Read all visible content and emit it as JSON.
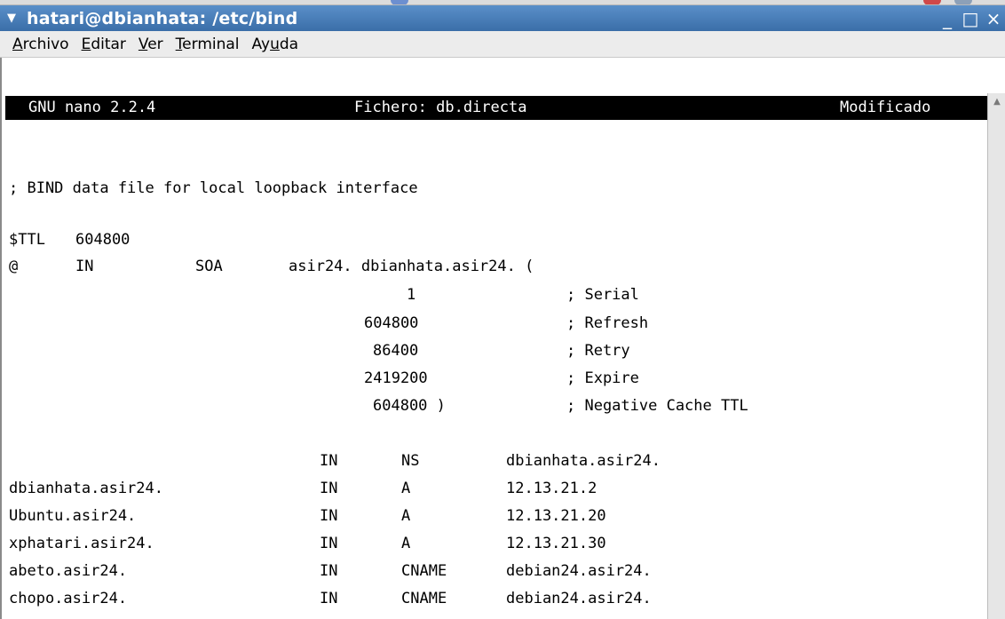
{
  "window": {
    "title": "hatari@dbianhata: /etc/bind",
    "menu_arrow": "▼",
    "controls": {
      "minimize": "_",
      "maximize": "□",
      "close": "×"
    }
  },
  "menubar": {
    "items": [
      {
        "label": "Archivo",
        "mnemonic": "A",
        "rest": "rchivo"
      },
      {
        "label": "Editar",
        "mnemonic": "E",
        "rest": "ditar"
      },
      {
        "label": "Ver",
        "mnemonic": "V",
        "rest": "er"
      },
      {
        "label": "Terminal",
        "mnemonic": "T",
        "rest": "erminal"
      },
      {
        "label": "Ayuda",
        "pre": "Ay",
        "mnemonic": "u",
        "rest": "da"
      }
    ]
  },
  "nano": {
    "version": "GNU nano 2.2.4",
    "file": "Fichero: db.directa",
    "status": "Modificado"
  },
  "file": {
    "comment": "; BIND data file for local loopback interface",
    "ttl": {
      "label": "$TTL",
      "value": "604800"
    },
    "soa": {
      "at": "@",
      "class": "IN",
      "type": "SOA",
      "value": "asir24. dbianhata.asir24. ("
    },
    "soa_fields": [
      {
        "value": "1",
        "comment": "; Serial"
      },
      {
        "value": "604800",
        "comment": "; Refresh"
      },
      {
        "value": "86400",
        "comment": "; Retry"
      },
      {
        "value": "2419200",
        "comment": "; Expire"
      },
      {
        "value": "604800 )",
        "comment": "; Negative Cache TTL"
      }
    ],
    "records": [
      {
        "name": "",
        "class": "IN",
        "type": "NS",
        "value": "dbianhata.asir24."
      },
      {
        "name": "dbianhata.asir24.",
        "class": "IN",
        "type": "A",
        "value": "12.13.21.2"
      },
      {
        "name": "Ubuntu.asir24.",
        "class": "IN",
        "type": "A",
        "value": "12.13.21.20"
      },
      {
        "name": "xphatari.asir24.",
        "class": "IN",
        "type": "A",
        "value": "12.13.21.30"
      },
      {
        "name": "abeto.asir24.",
        "class": "IN",
        "type": "CNAME",
        "value": "debian24.asir24."
      },
      {
        "name": "chopo.asir24.",
        "class": "IN",
        "type": "CNAME",
        "value": "debian24.asir24."
      }
    ]
  },
  "colors": {
    "titlebar": "#3a6ea8",
    "terminal_bg": "#ffffff",
    "nano_header_bg": "#000000"
  }
}
